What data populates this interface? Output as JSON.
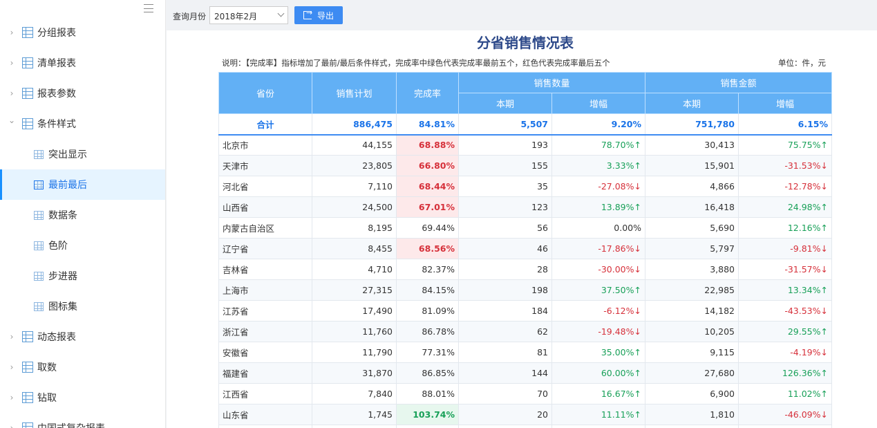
{
  "sidebar": {
    "items": [
      {
        "label": "分组报表",
        "chev": "›",
        "type": "top"
      },
      {
        "label": "清单报表",
        "chev": "›",
        "type": "top"
      },
      {
        "label": "报表参数",
        "chev": "›",
        "type": "top"
      },
      {
        "label": "条件样式",
        "chev": "⌄",
        "type": "top"
      },
      {
        "label": "突出显示",
        "type": "sub"
      },
      {
        "label": "最前最后",
        "type": "sub",
        "active": true
      },
      {
        "label": "数据条",
        "type": "sub"
      },
      {
        "label": "色阶",
        "type": "sub"
      },
      {
        "label": "步进器",
        "type": "sub"
      },
      {
        "label": "图标集",
        "type": "sub"
      },
      {
        "label": "动态报表",
        "chev": "›",
        "type": "top"
      },
      {
        "label": "取数",
        "chev": "›",
        "type": "top"
      },
      {
        "label": "钻取",
        "chev": "›",
        "type": "top"
      },
      {
        "label": "中国式复杂报表",
        "chev": "›",
        "type": "top"
      }
    ]
  },
  "toolbar": {
    "month_label": "查询月份",
    "month_value": "2018年2月",
    "export_label": "导出"
  },
  "report": {
    "title": "分省销售情况表",
    "note": "说明：【完成率】指标增加了最前/最后条件样式，完成率中绿色代表完成率最前五个，红色代表完成率最后五个",
    "unit": "单位：件，元",
    "headers": {
      "province": "省份",
      "plan": "销售计划",
      "rate": "完成率",
      "qty_group": "销售数量",
      "amt_group": "销售金额",
      "current": "本期",
      "growth": "增幅"
    },
    "total": {
      "prov": "合计",
      "plan": "886,475",
      "rate": "84.81%",
      "qty": "5,507",
      "qtyg": "9.20%",
      "amt": "751,780",
      "amtg": "6.15%"
    },
    "rows": [
      {
        "prov": "北京市",
        "plan": "44,155",
        "rate": "68.88%",
        "rs": "low",
        "qty": "193",
        "qtyg": "78.70%",
        "qd": "up",
        "amt": "30,413",
        "amtg": "75.75%",
        "ad": "up"
      },
      {
        "prov": "天津市",
        "plan": "23,805",
        "rate": "66.80%",
        "rs": "low",
        "qty": "155",
        "qtyg": "3.33%",
        "qd": "up",
        "amt": "15,901",
        "amtg": "-31.53%",
        "ad": "down"
      },
      {
        "prov": "河北省",
        "plan": "7,110",
        "rate": "68.44%",
        "rs": "low",
        "qty": "35",
        "qtyg": "-27.08%",
        "qd": "down",
        "amt": "4,866",
        "amtg": "-12.78%",
        "ad": "down"
      },
      {
        "prov": "山西省",
        "plan": "24,500",
        "rate": "67.01%",
        "rs": "low",
        "qty": "123",
        "qtyg": "13.89%",
        "qd": "up",
        "amt": "16,418",
        "amtg": "24.98%",
        "ad": "up"
      },
      {
        "prov": "内蒙古自治区",
        "plan": "8,195",
        "rate": "69.44%",
        "rs": "",
        "qty": "56",
        "qtyg": "0.00%",
        "qd": "none",
        "amt": "5,690",
        "amtg": "12.16%",
        "ad": "up"
      },
      {
        "prov": "辽宁省",
        "plan": "8,455",
        "rate": "68.56%",
        "rs": "low",
        "qty": "46",
        "qtyg": "-17.86%",
        "qd": "down",
        "amt": "5,797",
        "amtg": "-9.81%",
        "ad": "down"
      },
      {
        "prov": "吉林省",
        "plan": "4,710",
        "rate": "82.37%",
        "rs": "",
        "qty": "28",
        "qtyg": "-30.00%",
        "qd": "down",
        "amt": "3,880",
        "amtg": "-31.57%",
        "ad": "down"
      },
      {
        "prov": "上海市",
        "plan": "27,315",
        "rate": "84.15%",
        "rs": "",
        "qty": "198",
        "qtyg": "37.50%",
        "qd": "up",
        "amt": "22,985",
        "amtg": "13.34%",
        "ad": "up"
      },
      {
        "prov": "江苏省",
        "plan": "17,490",
        "rate": "81.09%",
        "rs": "",
        "qty": "184",
        "qtyg": "-6.12%",
        "qd": "down",
        "amt": "14,182",
        "amtg": "-43.53%",
        "ad": "down"
      },
      {
        "prov": "浙江省",
        "plan": "11,760",
        "rate": "86.78%",
        "rs": "",
        "qty": "62",
        "qtyg": "-19.48%",
        "qd": "down",
        "amt": "10,205",
        "amtg": "29.55%",
        "ad": "up"
      },
      {
        "prov": "安徽省",
        "plan": "11,790",
        "rate": "77.31%",
        "rs": "",
        "qty": "81",
        "qtyg": "35.00%",
        "qd": "up",
        "amt": "9,115",
        "amtg": "-4.19%",
        "ad": "down"
      },
      {
        "prov": "福建省",
        "plan": "31,870",
        "rate": "86.85%",
        "rs": "",
        "qty": "144",
        "qtyg": "60.00%",
        "qd": "up",
        "amt": "27,680",
        "amtg": "126.36%",
        "ad": "up"
      },
      {
        "prov": "江西省",
        "plan": "7,840",
        "rate": "88.01%",
        "rs": "",
        "qty": "70",
        "qtyg": "16.67%",
        "qd": "up",
        "amt": "6,900",
        "amtg": "11.02%",
        "ad": "up"
      },
      {
        "prov": "山东省",
        "plan": "1,745",
        "rate": "103.74%",
        "rs": "high",
        "qty": "20",
        "qtyg": "11.11%",
        "qd": "up",
        "amt": "1,810",
        "amtg": "-46.09%",
        "ad": "down"
      },
      {
        "prov": "",
        "plan": "",
        "rate": "",
        "rs": "",
        "qty": "",
        "qtyg": "",
        "qd": "none",
        "amt": "",
        "amtg": "",
        "ad": "none"
      }
    ]
  },
  "colors": {
    "accent": "#3d8bf2",
    "header": "#62b0f5",
    "up": "#18a058",
    "down": "#d6303a",
    "title": "#2e4a8a"
  },
  "icons": {
    "up": "up-arrow-icon",
    "down": "down-arrow-icon"
  }
}
